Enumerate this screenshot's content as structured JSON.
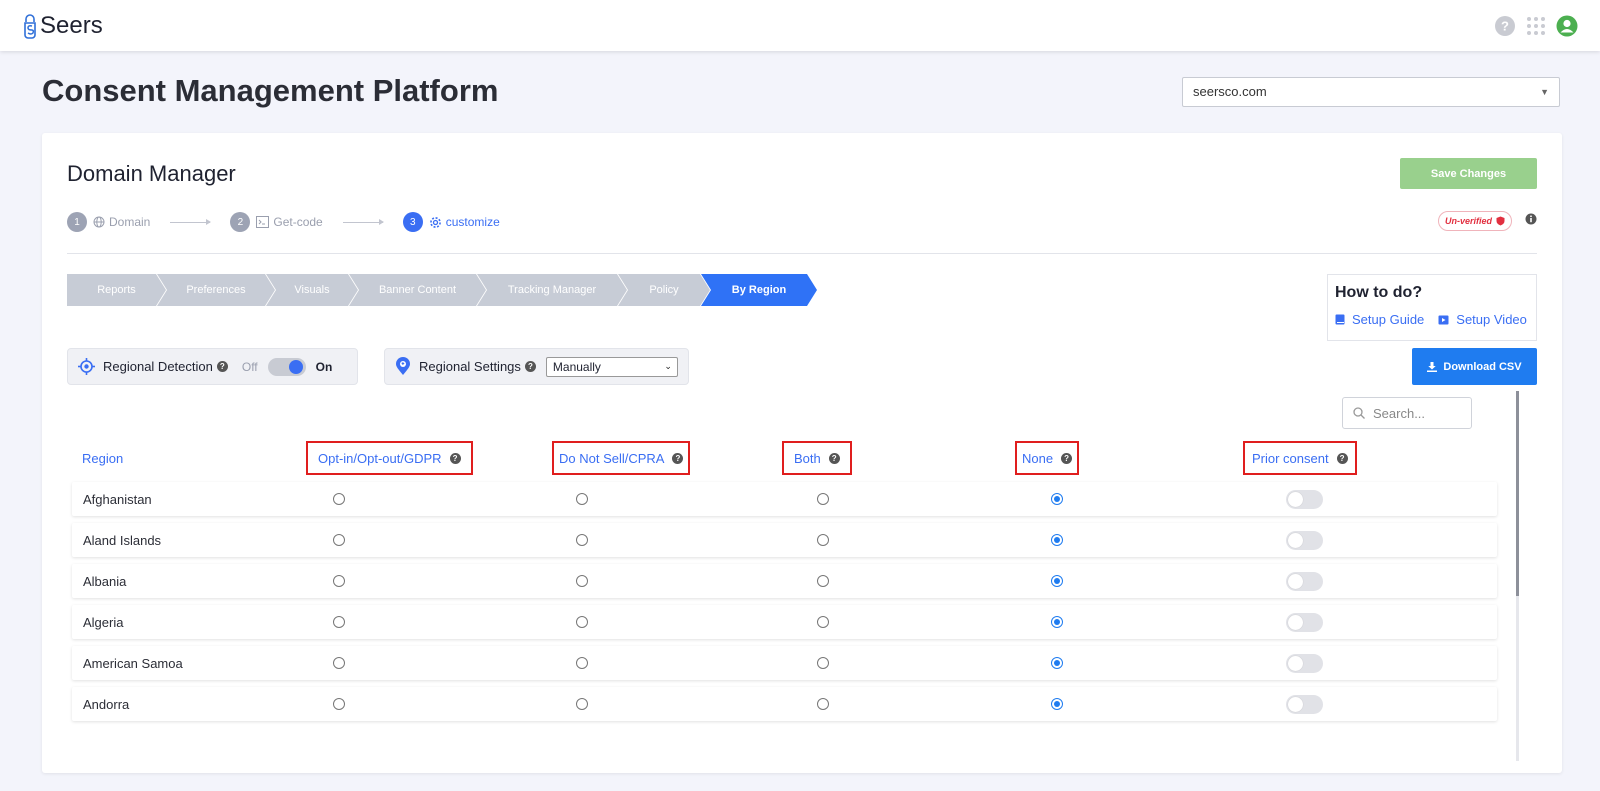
{
  "app": {
    "logo_text": "Seers"
  },
  "header": {
    "title": "Consent Management Platform",
    "domain_value": "seersco.com"
  },
  "card": {
    "title": "Domain Manager",
    "save_label": "Save Changes",
    "status_badge": "Un-verified"
  },
  "steps": [
    {
      "num": "1",
      "label": "Domain"
    },
    {
      "num": "2",
      "label": "Get-code"
    },
    {
      "num": "3",
      "label": "customize"
    }
  ],
  "tabs": [
    "Reports",
    "Preferences",
    "Visuals",
    "Banner Content",
    "Tracking Manager",
    "Policy",
    "By Region"
  ],
  "howto": {
    "title": "How to do?",
    "guide": "Setup Guide",
    "video": "Setup Video"
  },
  "download_label": "Download CSV",
  "regional_detection": {
    "label": "Regional Detection",
    "off": "Off",
    "on": "On"
  },
  "regional_settings": {
    "label": "Regional Settings",
    "value": "Manually"
  },
  "search": {
    "placeholder": "Search..."
  },
  "table": {
    "headers": [
      "Region",
      "Opt-in/Opt-out/GDPR",
      "Do Not Sell/CPRA",
      "Both",
      "None",
      "Prior consent"
    ],
    "rows": [
      {
        "name": "Afghanistan",
        "selected": "None",
        "prior_consent": false
      },
      {
        "name": "Aland Islands",
        "selected": "None",
        "prior_consent": false
      },
      {
        "name": "Albania",
        "selected": "None",
        "prior_consent": false
      },
      {
        "name": "Algeria",
        "selected": "None",
        "prior_consent": false
      },
      {
        "name": "American Samoa",
        "selected": "None",
        "prior_consent": false
      },
      {
        "name": "Andorra",
        "selected": "None",
        "prior_consent": false
      }
    ]
  },
  "colors": {
    "accent": "#3a6ef3",
    "download": "#1f7cf0",
    "save": "#99d08d",
    "highlight_box": "#e01e1e"
  }
}
